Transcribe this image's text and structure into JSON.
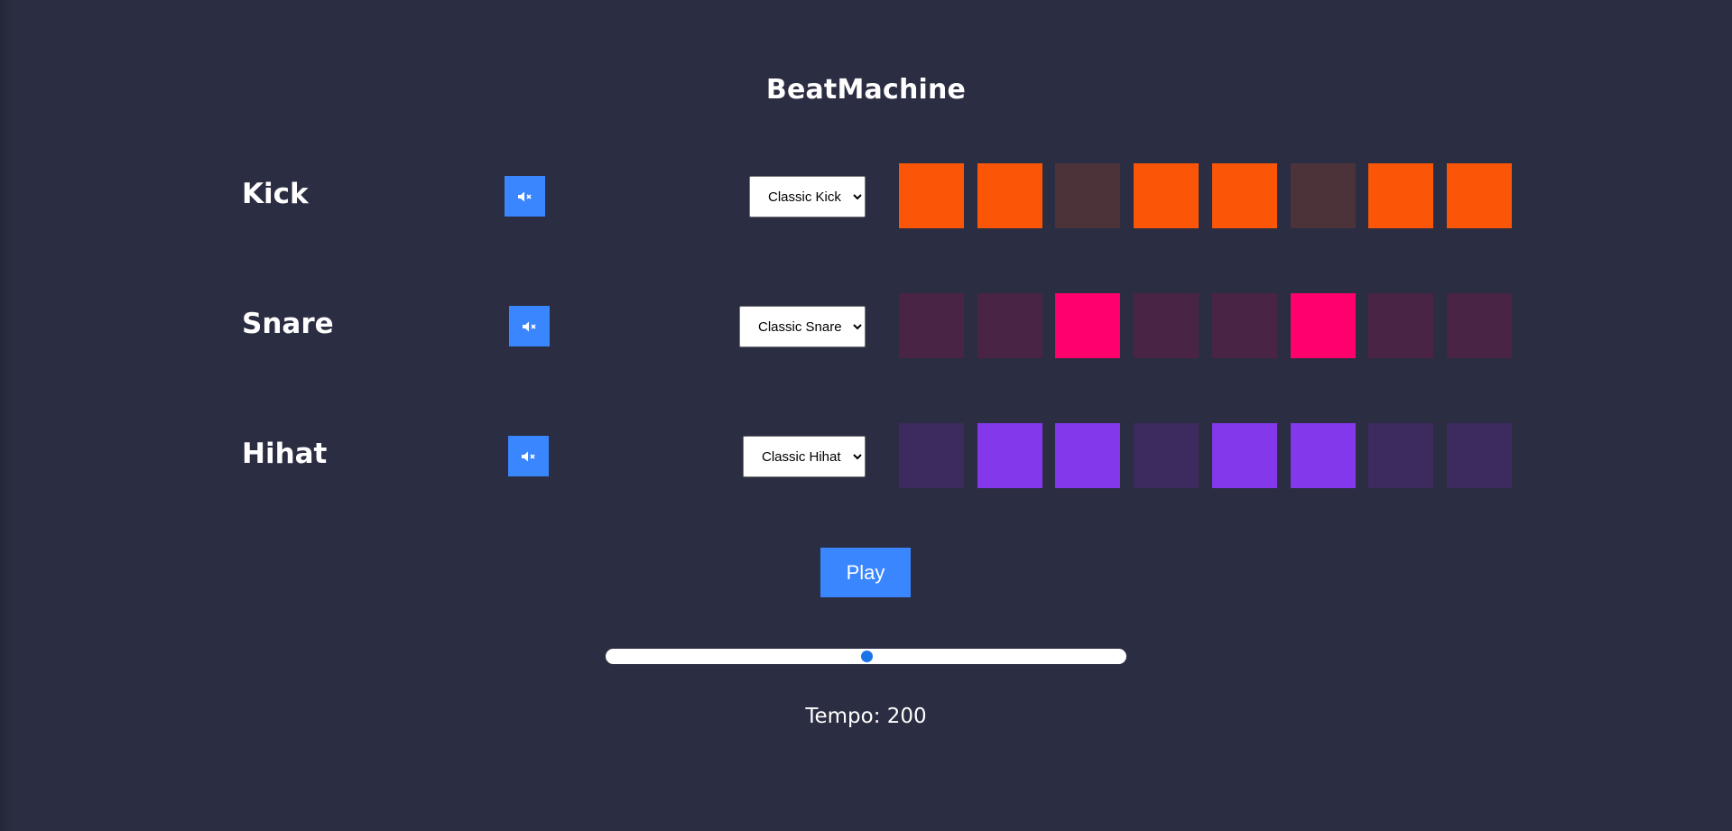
{
  "app": {
    "title": "BeatMachine"
  },
  "colors": {
    "background": "#2b2d42",
    "accent": "#3a86ff",
    "kick_active": "#fb5607",
    "kick_inactive": "#4c3239",
    "snare_active": "#ff006e",
    "snare_inactive": "#4a2445",
    "hihat_active": "#8338ec",
    "hihat_inactive": "#3d2a5e"
  },
  "tracks": [
    {
      "name": "Kick",
      "mute_icon": "speaker-muted-icon",
      "selected_sound": "Classic Kick",
      "pads": [
        true,
        true,
        false,
        true,
        true,
        false,
        true,
        true
      ]
    },
    {
      "name": "Snare",
      "mute_icon": "speaker-muted-icon",
      "selected_sound": "Classic Snare",
      "pads": [
        false,
        false,
        true,
        false,
        false,
        true,
        false,
        false
      ]
    },
    {
      "name": "Hihat",
      "mute_icon": "speaker-muted-icon",
      "selected_sound": "Classic Hihat",
      "pads": [
        false,
        true,
        true,
        false,
        true,
        true,
        false,
        false
      ]
    }
  ],
  "controls": {
    "play_label": "Play",
    "tempo_fraction": 0.5,
    "tempo_label": "Tempo: 200"
  }
}
